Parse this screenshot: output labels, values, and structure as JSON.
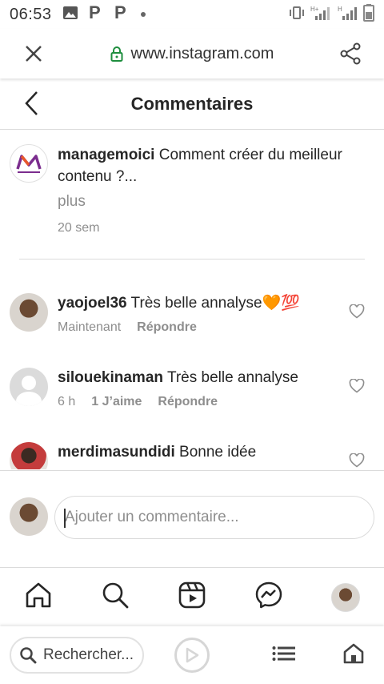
{
  "status_bar": {
    "time": "06:53",
    "network_label_1": "H+",
    "network_label_2": "H"
  },
  "browser": {
    "url": "www.instagram.com",
    "search_label": "Rechercher..."
  },
  "header": {
    "title": "Commentaires"
  },
  "caption": {
    "username": "managemoici",
    "text": "Comment créer du meilleur contenu ?...",
    "more": "plus",
    "time": "20 sem"
  },
  "comments": [
    {
      "username": "yaojoel36",
      "text": "Très belle annalyse🧡💯",
      "time": "Maintenant",
      "likes": "",
      "reply": "Répondre"
    },
    {
      "username": "silouekinaman",
      "text": "Très belle annalyse",
      "time": "6 h",
      "likes": "1 J’aime",
      "reply": "Répondre"
    },
    {
      "username": "merdimasundidi",
      "text": "Bonne idée",
      "time": "",
      "likes": "",
      "reply": ""
    }
  ],
  "add_comment": {
    "placeholder": "Ajouter un commentaire..."
  },
  "colors": {
    "text": "#262626",
    "muted": "#8e8e8e",
    "border": "#dbdbdb",
    "lock": "#1e8e3e",
    "brand_purple": "#7b2d8e",
    "brand_orange": "#e8582b"
  }
}
